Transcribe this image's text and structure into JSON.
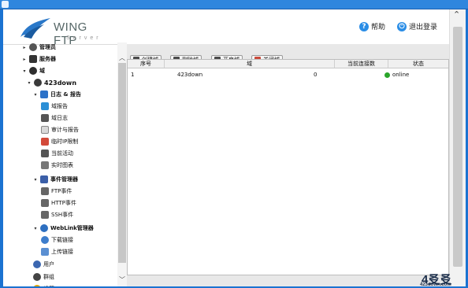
{
  "header": {
    "brand": "WING FTP",
    "brand_sub": "Server",
    "help_label": "帮助",
    "logout_label": "退出登录"
  },
  "tree": {
    "admins": "管理员",
    "servers": "服务器",
    "domains": "域",
    "domain_name": "423down",
    "logs_reports": "日志 & 报告",
    "domain_report": "域报告",
    "domain_log": "域日志",
    "audit_report": "审计与报告",
    "temp_ip": "临时IP限制",
    "current_activity": "当前活动",
    "realtime_chart": "实时图表",
    "event_manager": "事件管理器",
    "ftp_event": "FTP事件",
    "http_event": "HTTP事件",
    "ssh_event": "SSH事件",
    "weblink_manager": "WebLink管理器",
    "download_links": "下载链接",
    "upload_links": "上传链接",
    "users": "用户",
    "groups": "群组",
    "settings": "设置"
  },
  "toolbar": {
    "create": "创建域",
    "delete": "删除域",
    "start": "开启域",
    "stop": "关闭域"
  },
  "table": {
    "columns": [
      "序号",
      "域",
      "当前连接数",
      "状态"
    ],
    "rows": [
      {
        "index": "1",
        "domain": "423down",
        "connections": "0",
        "status": "online"
      }
    ]
  },
  "watermark": {
    "big": "4㕛㕛",
    "small": "423down.com"
  },
  "colors": {
    "titlebar": "#2f86de",
    "status_online": "#2aa52a",
    "help_icon": "#2a8de6",
    "logout_icon": "#2a8de6"
  }
}
